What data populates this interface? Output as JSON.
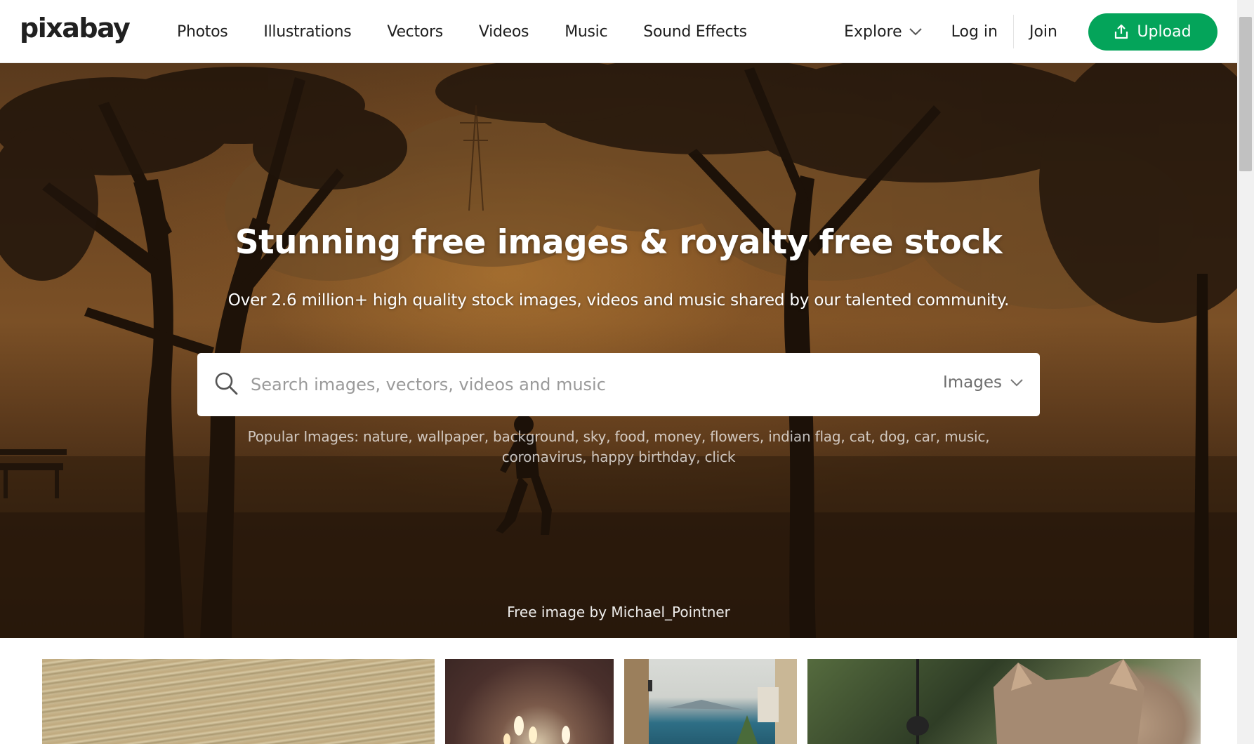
{
  "header": {
    "logo": "pixabay",
    "nav": [
      "Photos",
      "Illustrations",
      "Vectors",
      "Videos",
      "Music",
      "Sound Effects"
    ],
    "explore_label": "Explore",
    "login_label": "Log in",
    "join_label": "Join",
    "upload_label": "Upload",
    "brand_color": "#04a45a"
  },
  "hero": {
    "title": "Stunning free images & royalty free stock",
    "subtitle": "Over 2.6 million+ high quality stock images, videos and music shared by our talented community.",
    "search": {
      "placeholder": "Search images, vectors, videos and music",
      "value": "",
      "type_selected": "Images"
    },
    "popular_prefix": "Popular Images:",
    "popular_tags": [
      "nature",
      "wallpaper",
      "background",
      "sky",
      "food",
      "money",
      "flowers",
      "indian flag",
      "cat",
      "dog",
      "car",
      "music",
      "coronavirus",
      "happy birthday",
      "click"
    ],
    "credit": "Free image by Michael_Pointner"
  },
  "icons": {
    "search": "search-icon",
    "upload": "upload-icon",
    "chevron": "chevron-down-icon"
  }
}
